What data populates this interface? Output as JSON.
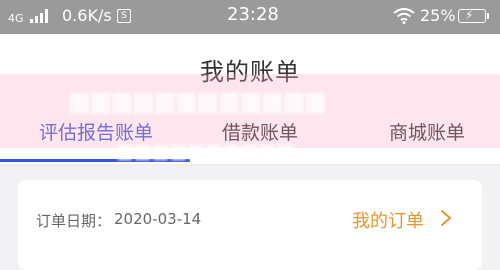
{
  "status_bar": {
    "network_type": "4G",
    "speed": "0.6K/s",
    "speed_icon": "S",
    "time": "23:28",
    "battery_percent": "25%"
  },
  "header": {
    "title": "我的账单"
  },
  "tabs": [
    {
      "label": "评估报告账单",
      "active": true
    },
    {
      "label": "借款账单",
      "active": false
    },
    {
      "label": "商城账单",
      "active": false
    }
  ],
  "order_card": {
    "date_label": "订单日期：",
    "date_value": "2020-03-14",
    "link_label": "我的订单"
  },
  "colors": {
    "accent_blue": "#3355e0",
    "link_orange": "#e8952e",
    "status_bar_gray": "#9a9a9a"
  },
  "icons": [
    "signal-icon",
    "speed-box-icon",
    "wifi-icon",
    "battery-icon",
    "chevron-right-icon"
  ]
}
